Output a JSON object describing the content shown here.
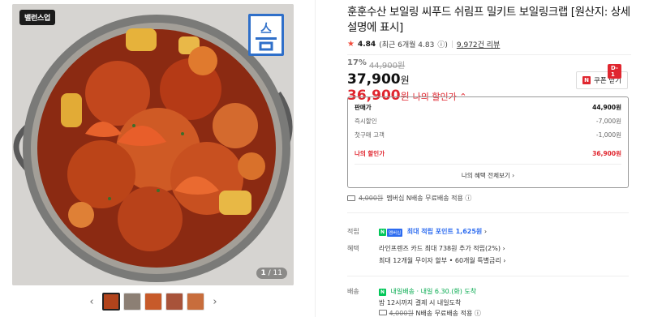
{
  "image": {
    "badge": "밸런스업",
    "counter_current": "1",
    "counter_total": "/ 11",
    "thumb_prev": "‹",
    "thumb_next": "›",
    "thumbnails": 5
  },
  "product": {
    "title": "훈훈수산 보일링 씨푸드 쉬림프 밀키트 보일링크랩 [원산지: 상세설명에 표시]",
    "rating": "4.84",
    "rating_recent": "(최근 6개월 4.83",
    "rating_info": "ⓘ)",
    "reviews": "9,972건 리뷰",
    "discount_rate": "17%",
    "original_price": "44,900원",
    "price": "37,900",
    "price_unit": "원",
    "my_price": "36,900",
    "my_price_unit": "원",
    "my_price_label": "나의 할인가 ⌃"
  },
  "coupon": {
    "dday": "D-1",
    "label": "쿠폰 받기"
  },
  "price_box": {
    "rows": [
      {
        "label": "판매가",
        "value": "44,900원"
      },
      {
        "label": "즉시할인",
        "value": "-7,000원"
      },
      {
        "label": "첫구매 고객",
        "value": "-1,000원"
      }
    ],
    "mine_label": "나의 할인가",
    "mine_value": "36,900원",
    "more": "나의 혜택 전체보기 ›"
  },
  "delivery_note": {
    "old": "4,000원",
    "text": "멤버십 N배송 무료배송 적용 ⓘ"
  },
  "points": {
    "label": "적립",
    "tag": "멤버십",
    "text": "최대 적립 포인트 1,625원",
    "arrow": "›"
  },
  "benefit": {
    "label": "혜택",
    "line1": "라인프렌즈 카드 최대 738원 추가 적립(2%) ›",
    "line2": "최대 12개월 무이자 할부 • 60개월 특별금리 ›"
  },
  "shipping": {
    "label": "배송",
    "brand": "내일배송",
    "eta": "· 내일 6.30.(화) 도착",
    "cutoff": "밤 12시까지 결제 시 내일도착",
    "old": "4,000원",
    "text": "N배송 무료배송 적용 ⓘ"
  },
  "colors": {
    "accent_red": "#e0262f",
    "npay_green": "#03c75a",
    "point_blue": "#2d6cf0"
  }
}
